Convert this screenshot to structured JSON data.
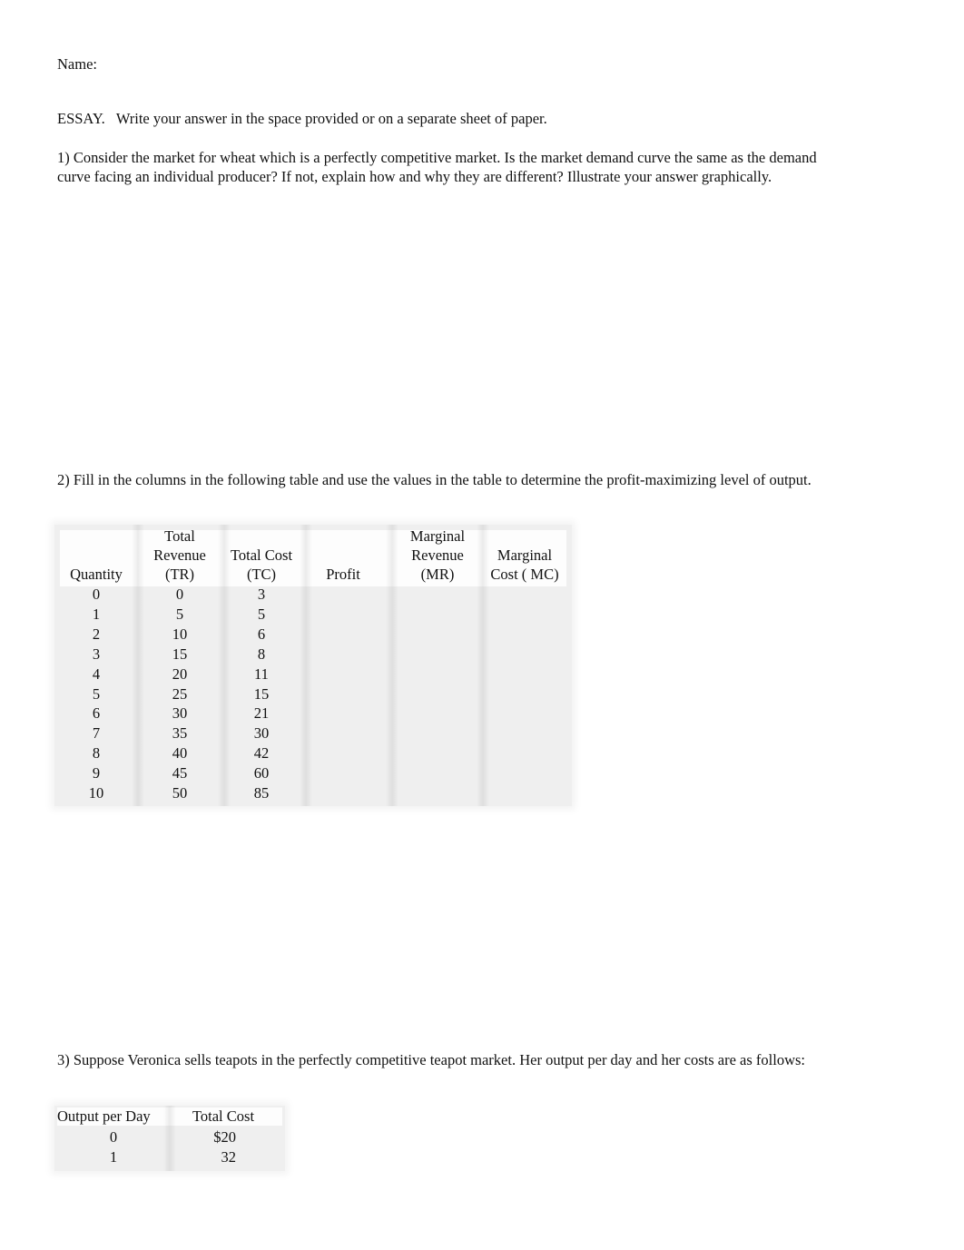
{
  "name_label": "Name:",
  "instructions": "ESSAY.   Write your answer in the space provided or on a separate sheet of paper.",
  "questions": [
    {
      "text": "1) Consider the market for wheat which is a perfectly competitive market. Is the market demand curve the same as the demand curve facing an individual producer? If not, explain how and why they are different? Illustrate your answer graphically."
    },
    {
      "text": "2) Fill in the columns in the following table and use the values in the table to determine the profit-maximizing level of output."
    },
    {
      "text": "3) Suppose Veronica sells teapots in the perfectly competitive teapot market. Her output per day and her costs are as follows:"
    }
  ],
  "table1": {
    "headers": [
      [
        "",
        "",
        "Quantity"
      ],
      [
        "Total",
        "Revenue",
        "(TR)"
      ],
      [
        "",
        "Total Cost",
        "(TC)"
      ],
      [
        "",
        "",
        "Profit"
      ],
      [
        "Marginal",
        "Revenue",
        "(MR)"
      ],
      [
        "",
        "Marginal",
        "Cost ( MC)"
      ]
    ],
    "rows": [
      [
        "0",
        "0",
        "3",
        "",
        "",
        ""
      ],
      [
        "1",
        "5",
        "5",
        "",
        "",
        ""
      ],
      [
        "2",
        "10",
        "6",
        "",
        "",
        ""
      ],
      [
        "3",
        "15",
        "8",
        "",
        "",
        ""
      ],
      [
        "4",
        "20",
        "11",
        "",
        "",
        ""
      ],
      [
        "5",
        "25",
        "15",
        "",
        "",
        ""
      ],
      [
        "6",
        "30",
        "21",
        "",
        "",
        ""
      ],
      [
        "7",
        "35",
        "30",
        "",
        "",
        ""
      ],
      [
        "8",
        "40",
        "42",
        "",
        "",
        ""
      ],
      [
        "9",
        "45",
        "60",
        "",
        "",
        ""
      ],
      [
        "10",
        "50",
        "85",
        "",
        "",
        ""
      ]
    ]
  },
  "table2": {
    "headers": [
      "Output per Day",
      "Total Cost"
    ],
    "rows": [
      [
        "0",
        "$20"
      ],
      [
        "1",
        "32"
      ]
    ]
  }
}
